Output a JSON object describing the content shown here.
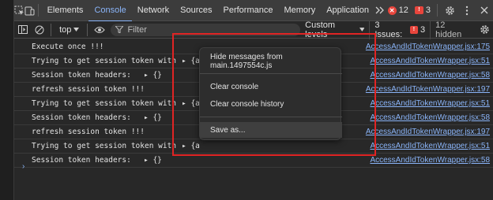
{
  "tabs": [
    {
      "label": "Elements",
      "active": false
    },
    {
      "label": "Console",
      "active": true
    },
    {
      "label": "Network",
      "active": false
    },
    {
      "label": "Sources",
      "active": false
    },
    {
      "label": "Performance",
      "active": false
    },
    {
      "label": "Memory",
      "active": false
    },
    {
      "label": "Application",
      "active": false
    }
  ],
  "tabbar": {
    "more_icon": "double-chevron-right",
    "error_count": "12",
    "warning_count": "3",
    "error_glyph": "✕",
    "warning_glyph": "!"
  },
  "toolbar": {
    "context": "top",
    "filter_placeholder": "Filter",
    "levels_label": "Custom levels",
    "issues_label": "3 Issues:",
    "issues_count": "3",
    "hidden_label": "12 hidden"
  },
  "log": [
    {
      "message": "Execute once !!!",
      "source": "AccessAndIdTokenWrapper.jsx:175"
    },
    {
      "message": "Trying to get session token with",
      "obj": "▸ {a",
      "source": "AccessAndIdTokenWrapper.jsx:51"
    },
    {
      "message": "Session token headers:",
      "obj": "▸ {}",
      "source": "AccessAndIdTokenWrapper.jsx:58"
    },
    {
      "message": "refresh session token !!!",
      "source": "AccessAndIdTokenWrapper.jsx:197"
    },
    {
      "message": "Trying to get session token with",
      "obj": "▸ {a",
      "source": "AccessAndIdTokenWrapper.jsx:51"
    },
    {
      "message": "Session token headers:",
      "obj": "▸ {}",
      "source": "AccessAndIdTokenWrapper.jsx:58"
    },
    {
      "message": "refresh session token !!!",
      "source": "AccessAndIdTokenWrapper.jsx:197"
    },
    {
      "message": "Trying to get session token with",
      "obj": "▸ {a",
      "source": "AccessAndIdTokenWrapper.jsx:51"
    },
    {
      "message": "Session token headers:",
      "obj": "▸ {}",
      "source": "AccessAndIdTokenWrapper.jsx:58"
    }
  ],
  "prompt_glyph": "›",
  "context_menu": {
    "hide_messages": "Hide messages from main.1497554c.js",
    "clear_console": "Clear console",
    "clear_history": "Clear console history",
    "save_as": "Save as..."
  },
  "colors": {
    "accent": "#8ab4f8",
    "error": "#e8453c",
    "annotation": "#e02424"
  }
}
